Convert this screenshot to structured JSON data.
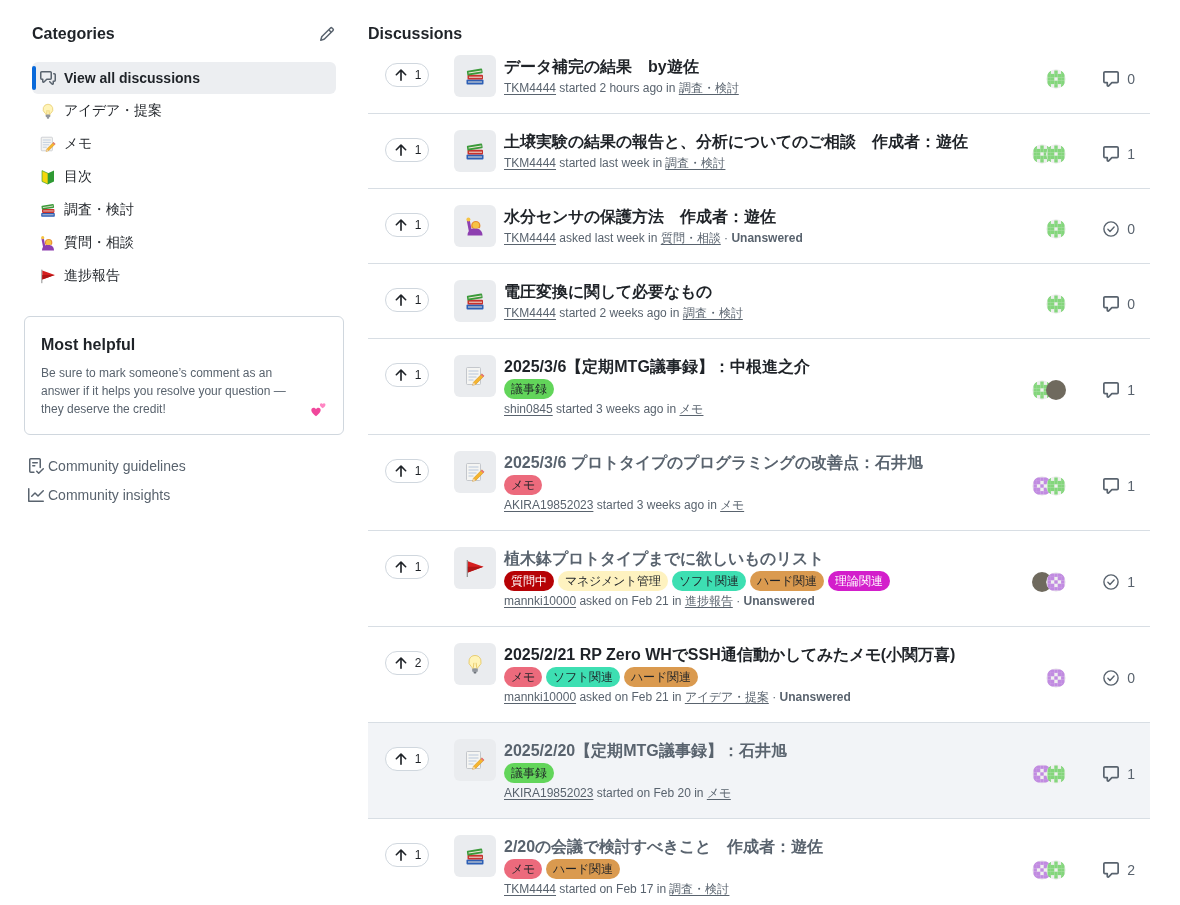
{
  "sidebar": {
    "title": "Categories",
    "categories": [
      {
        "label": "View all discussions",
        "kind": "all",
        "selected": true
      },
      {
        "label": "アイデア・提案",
        "kind": "bulb",
        "selected": false
      },
      {
        "label": "メモ",
        "kind": "memo",
        "selected": false
      },
      {
        "label": "目次",
        "kind": "beginner",
        "selected": false
      },
      {
        "label": "調査・検討",
        "kind": "books",
        "selected": false
      },
      {
        "label": "質問・相談",
        "kind": "raised-hand",
        "selected": false
      },
      {
        "label": "進捗報告",
        "kind": "flag",
        "selected": false
      }
    ],
    "help_card": {
      "title": "Most helpful",
      "text": "Be sure to mark someone’s comment as an answer if it helps you resolve your question — they deserve the credit!"
    },
    "links": [
      {
        "label": "Community guidelines",
        "kind": "guidelines"
      },
      {
        "label": "Community insights",
        "kind": "insights"
      }
    ]
  },
  "discussions": {
    "title": "Discussions",
    "items": [
      {
        "votes": "1",
        "kind": "books",
        "title": "データ補完の結果　by遊佐",
        "read": false,
        "hovered": false,
        "author": "TKM4444",
        "action": "started 2 hours ago in",
        "category": "調査・検討",
        "avatars": [
          {
            "kind": "identicon",
            "color": "#84d67c"
          }
        ],
        "comments": {
          "kind": "discussion",
          "count": "0"
        }
      },
      {
        "votes": "1",
        "kind": "books",
        "title": "土壌実験の結果の報告と、分析についてのご相談　作成者：遊佐",
        "read": false,
        "hovered": false,
        "author": "TKM4444",
        "action": "started last week in",
        "category": "調査・検討",
        "avatars": [
          {
            "kind": "identicon",
            "color": "#84d67c"
          },
          {
            "kind": "identicon",
            "color": "#84d67c"
          }
        ],
        "comments": {
          "kind": "discussion",
          "count": "1"
        }
      },
      {
        "votes": "1",
        "kind": "raised-hand",
        "title": "水分センサの保護方法　作成者：遊佐",
        "read": false,
        "hovered": false,
        "author": "TKM4444",
        "action": "asked last week in",
        "category": "質問・相談",
        "status": "· **Unanswered**",
        "avatars": [
          {
            "kind": "identicon",
            "color": "#84d67c"
          }
        ],
        "comments": {
          "kind": "question",
          "count": "0"
        }
      },
      {
        "votes": "1",
        "kind": "books",
        "title": "電圧変換に関して必要なもの",
        "read": false,
        "hovered": false,
        "author": "TKM4444",
        "action": "started 2 weeks ago in",
        "category": "調査・検討",
        "avatars": [
          {
            "kind": "identicon",
            "color": "#84d67c"
          }
        ],
        "comments": {
          "kind": "discussion",
          "count": "0"
        }
      },
      {
        "votes": "1",
        "kind": "memo",
        "title": "2025/3/6【定期MTG議事録】：中根進之介",
        "read": false,
        "hovered": false,
        "labels": [
          {
            "name": "議事録",
            "color": "#62d55a"
          }
        ],
        "author": "shin0845",
        "action": "started 3 weeks ago in",
        "category": "メモ",
        "avatars": [
          {
            "kind": "identicon",
            "color": "#84d67c"
          },
          {
            "kind": "photo"
          }
        ],
        "comments": {
          "kind": "discussion",
          "count": "1"
        }
      },
      {
        "votes": "1",
        "kind": "memo",
        "title": "2025/3/6 プロトタイプのプログラミングの改善点：石井旭",
        "read": true,
        "hovered": false,
        "labels": [
          {
            "name": "メモ",
            "color": "#ec6a7c"
          }
        ],
        "author": "AKIRA19852023",
        "action": "started 3 weeks ago in",
        "category": "メモ",
        "avatars": [
          {
            "kind": "identicon",
            "color": "#c18be1"
          },
          {
            "kind": "identicon",
            "color": "#84d67c"
          }
        ],
        "comments": {
          "kind": "discussion",
          "count": "1"
        }
      },
      {
        "votes": "1",
        "kind": "flag",
        "title": "植木鉢プロトタイプまでに欲しいものリスト",
        "read": true,
        "hovered": false,
        "labels": [
          {
            "name": "質問中",
            "color": "#b60205"
          },
          {
            "name": "マネジメント管理",
            "color": "#fef2c0"
          },
          {
            "name": "ソフト関連",
            "color": "#3ddfb2"
          },
          {
            "name": "ハード関連",
            "color": "#da9a4f"
          },
          {
            "name": "理論関連",
            "color": "#d31ecb"
          }
        ],
        "author": "mannki10000",
        "action": "asked on Feb 21 in",
        "category": "進捗報告",
        "status": "· **Unanswered**",
        "avatars": [
          {
            "kind": "photo"
          },
          {
            "kind": "identicon",
            "color": "#c18be1"
          }
        ],
        "comments": {
          "kind": "question",
          "count": "1"
        }
      },
      {
        "votes": "2",
        "kind": "bulb",
        "title": "2025/2/21 RP Zero WHでSSH通信動かしてみたメモ(小関万喜)",
        "read": false,
        "hovered": false,
        "labels": [
          {
            "name": "メモ",
            "color": "#ec6a7c"
          },
          {
            "name": "ソフト関連",
            "color": "#3ddfb2"
          },
          {
            "name": "ハード関連",
            "color": "#da9a4f"
          }
        ],
        "author": "mannki10000",
        "action": "asked on Feb 21 in",
        "category": "アイデア・提案",
        "status": "· **Unanswered**",
        "avatars": [
          {
            "kind": "identicon",
            "color": "#c18be1"
          }
        ],
        "comments": {
          "kind": "question",
          "count": "0"
        }
      },
      {
        "votes": "1",
        "kind": "memo",
        "title": "2025/2/20【定期MTG議事録】：石井旭",
        "read": true,
        "hovered": true,
        "labels": [
          {
            "name": "議事録",
            "color": "#62d55a"
          }
        ],
        "author": "AKIRA19852023",
        "action": "started on Feb 20 in",
        "category": "メモ",
        "avatars": [
          {
            "kind": "identicon",
            "color": "#c18be1"
          },
          {
            "kind": "identicon",
            "color": "#84d67c"
          }
        ],
        "comments": {
          "kind": "discussion",
          "count": "1"
        }
      },
      {
        "votes": "1",
        "kind": "books",
        "title": "2/20の会議で検討すべきこと　作成者：遊佐",
        "read": true,
        "hovered": false,
        "labels": [
          {
            "name": "メモ",
            "color": "#ec6a7c"
          },
          {
            "name": "ハード関連",
            "color": "#da9a4f"
          }
        ],
        "author": "TKM4444",
        "action": "started on Feb 17 in",
        "category": "調査・検討",
        "avatars": [
          {
            "kind": "identicon",
            "color": "#c18be1"
          },
          {
            "kind": "identicon",
            "color": "#84d67c"
          }
        ],
        "comments": {
          "kind": "discussion",
          "count": "2"
        }
      }
    ]
  }
}
